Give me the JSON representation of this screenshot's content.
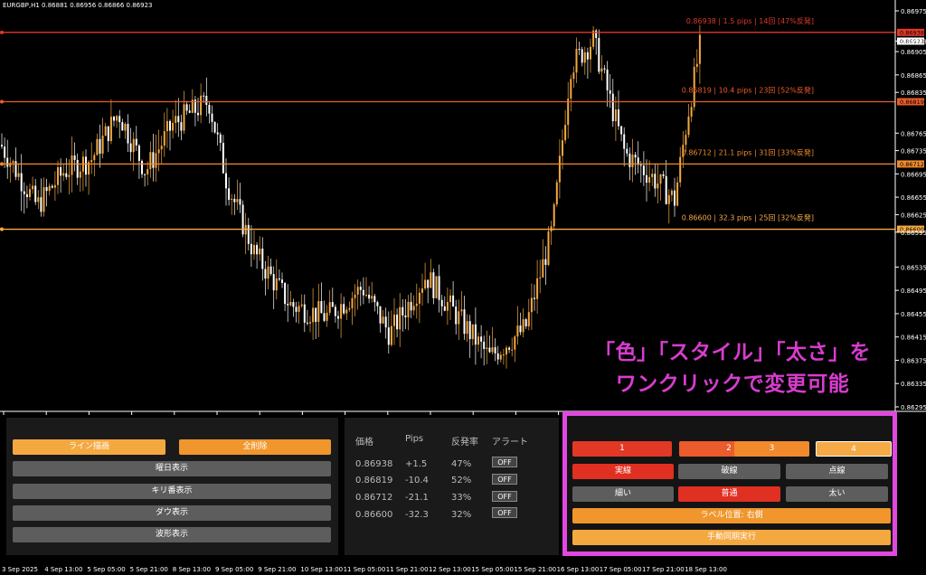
{
  "symbol_info": "EURGBP,H1  0.86881 0.86956 0.86866 0.86923",
  "price_axis": [
    "0.86975",
    "0.86923",
    "0.86905",
    "0.86865",
    "0.86835",
    "0.86765",
    "0.86735",
    "0.86695",
    "0.86655",
    "0.86625",
    "0.86595",
    "0.86535",
    "0.86495",
    "0.86455",
    "0.86415",
    "0.86375",
    "0.86335",
    "0.86295"
  ],
  "time_axis": [
    "3 Sep 2025",
    "4 Sep 13:00",
    "5 Sep 05:00",
    "5 Sep 21:00",
    "8 Sep 13:00",
    "9 Sep 05:00",
    "9 Sep 21:00",
    "10 Sep 13:00",
    "11 Sep 05:00",
    "11 Sep 21:00",
    "12 Sep 13:00",
    "15 Sep 05:00",
    "15 Sep 21:00",
    "16 Sep 13:00",
    "17 Sep 05:00",
    "17 Sep 21:00",
    "18 Sep 13:00"
  ],
  "levels": [
    {
      "price": "0.86938",
      "label": "0.86938 | 1.5 pips | 14回 [47%反発]",
      "color": "#e23826"
    },
    {
      "price": "0.86819",
      "label": "0.86819 | 10.4 pips | 23回 [52%反発]",
      "color": "#eb5b2b"
    },
    {
      "price": "0.86712",
      "label": "0.86712 | 21.1 pips | 31回 [33%反発]",
      "color": "#f08a2c"
    },
    {
      "price": "0.86600",
      "label": "0.86600 | 32.3 pips | 25回 [32%反発]",
      "color": "#f6aa46"
    }
  ],
  "current_price": "0.86923",
  "caption": {
    "line1": "「色」「スタイル」「太さ」を",
    "line2": "ワンクリックで変更可能"
  },
  "left_panel": {
    "draw_lines": "ライン描画",
    "delete_all": "全削除",
    "weekday": "曜日表示",
    "round_number": "キリ番表示",
    "dow": "ダウ表示",
    "wave": "波形表示"
  },
  "mid_panel": {
    "headers": {
      "price": "価格",
      "pips": "Pips",
      "rebound": "反発率",
      "alert": "アラート"
    },
    "rows": [
      {
        "price": "0.86938",
        "pips": "+1.5",
        "rate": "47%",
        "alert": "OFF"
      },
      {
        "price": "0.86819",
        "pips": "-10.4",
        "rate": "52%",
        "alert": "OFF"
      },
      {
        "price": "0.86712",
        "pips": "-21.1",
        "rate": "33%",
        "alert": "OFF"
      },
      {
        "price": "0.86600",
        "pips": "-32.3",
        "rate": "32%",
        "alert": "OFF"
      }
    ]
  },
  "right_panel": {
    "color_1": "1",
    "color_2": "2",
    "color_3": "3",
    "color_4": "4",
    "style_solid": "実線",
    "style_dashed": "破線",
    "style_dotted": "点線",
    "width_thin": "細い",
    "width_normal": "普通",
    "width_thick": "太い",
    "label_pos": "ラベル位置: 右側",
    "manual_sync": "手動同期実行"
  }
}
